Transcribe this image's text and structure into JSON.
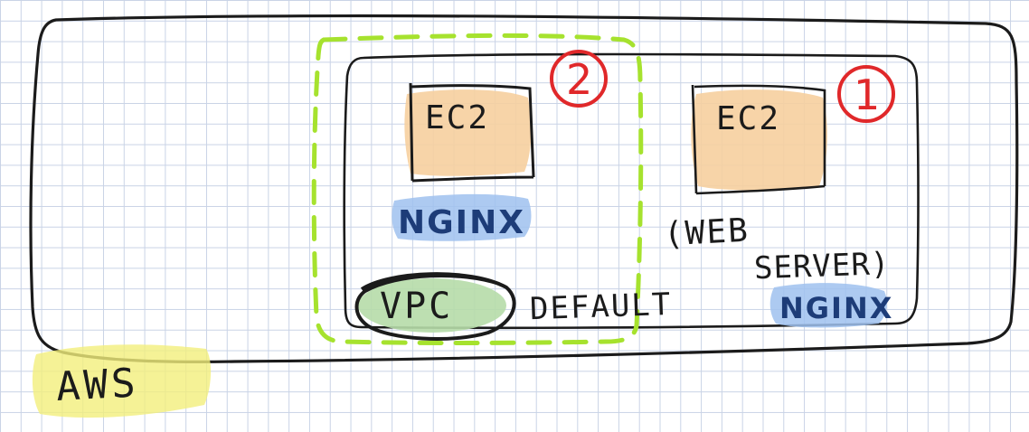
{
  "diagram": {
    "aws_label": "AWS",
    "vpc_label": "VPC",
    "default_label": "DEFAULT",
    "instance_1": {
      "number": "1",
      "ec2_label": "EC2",
      "web_server_line1": "(WEB",
      "web_server_line2": "SERVER)",
      "nginx_label": "NGINX"
    },
    "instance_2": {
      "number": "2",
      "ec2_label": "EC2",
      "nginx_label": "NGINX"
    }
  },
  "colors": {
    "ink": "#1b1b1b",
    "highlight_yellow": "#f3ef7c",
    "highlight_orange": "#f6cf9e",
    "highlight_blue": "#9fc1ee",
    "highlight_green": "#b6dca8",
    "dashed_green": "#a6e22e",
    "marker_red": "#e0282a",
    "nginx_text": "#1d3c78"
  }
}
